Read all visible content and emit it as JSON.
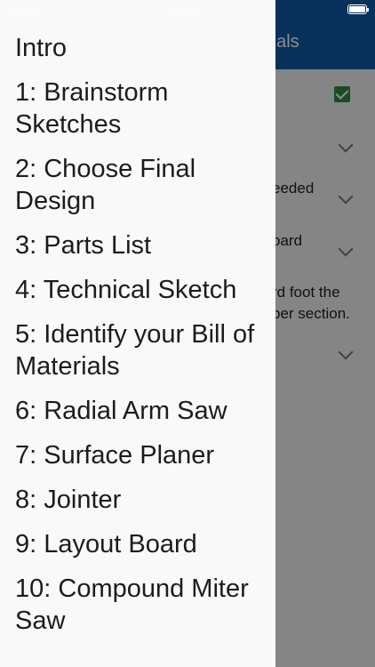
{
  "status_bar": {
    "carrier": "Carrier",
    "time": "4:10 AM"
  },
  "background": {
    "appbar_title": "rials",
    "rows": [
      "eeded",
      "oard",
      "rd foot the",
      "per section."
    ]
  },
  "drawer": {
    "items": [
      "Intro",
      "1: Brainstorm Sketches",
      "2: Choose Final Design",
      "3: Parts List",
      "4: Technical Sketch",
      "5: Identify your Bill of Materials",
      "6: Radial Arm Saw",
      "7: Surface Planer",
      "8: Jointer",
      "9: Layout Board",
      "10: Compound Miter Saw"
    ]
  },
  "colors": {
    "appbar": "#0d5aa6",
    "checkbox": "#2e8b3a",
    "drawer_bg": "#f9f9f9"
  }
}
